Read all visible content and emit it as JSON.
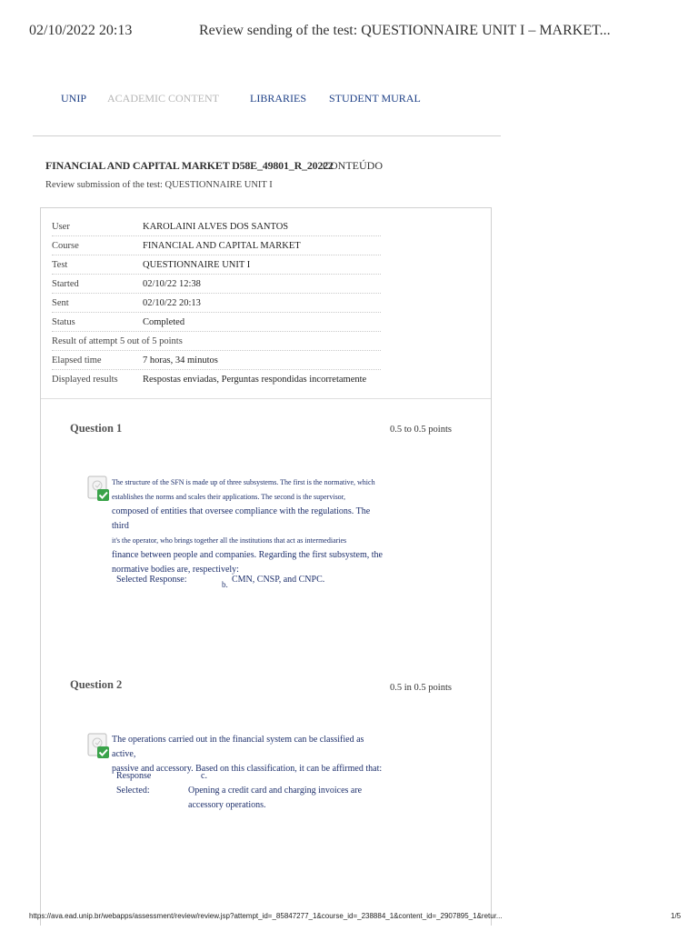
{
  "print": {
    "datetime": "02/10/2022 20:13",
    "title": "Review sending of the test: QUESTIONNAIRE UNIT I – MARKET...",
    "url": "https://ava.ead.unip.br/webapps/assessment/review/review.jsp?attempt_id=_85847277_1&course_id=_238884_1&content_id=_2907895_1&retur...",
    "page": "1/5"
  },
  "nav": {
    "unip": "UNIP",
    "academic": "ACADEMIC CONTENT",
    "libraries": "LIBRARIES",
    "mural": "STUDENT MURAL"
  },
  "course": {
    "title": "FINANCIAL AND CAPITAL MARKET D58E_49801_R_20222",
    "content_link": "CONTEÚDO",
    "review_subtitle": "Review submission of the test: QUESTIONNAIRE UNIT I"
  },
  "summary": {
    "user_label": "User",
    "user_value": "KAROLAINI ALVES DOS SANTOS",
    "course_label": "Course",
    "course_value": "FINANCIAL AND CAPITAL MARKET",
    "test_label": "Test",
    "test_value": "QUESTIONNAIRE UNIT I",
    "started_label": "Started",
    "started_value": "02/10/22 12:38",
    "sent_label": "Sent",
    "sent_value": "02/10/22 20:13",
    "status_label": "Status",
    "status_value": "Completed",
    "result_text": "Result of attempt 5 out of 5 points",
    "elapsed_label": "Elapsed time",
    "elapsed_value": "7 horas, 34 minutos",
    "displayed_label": "Displayed results",
    "displayed_value": "Respostas enviadas, Perguntas respondidas incorretamente"
  },
  "questions": [
    {
      "title": "Question 1",
      "points": "0.5 to 0.5 points",
      "line1": "The structure of the SFN is made up of three subsystems. The first is the normative, which",
      "line2": "establishes the norms and scales their applications. The second is the supervisor,",
      "line3": "composed of entities that oversee compliance with the regulations. The third",
      "line4": "it's the operator, who brings together all the institutions that act as intermediaries",
      "line5": "finance between people and companies. Regarding the first subsystem, the",
      "line6": "normative bodies are, respectively:",
      "response_label": "Selected Response:",
      "response_letter": "b.",
      "response_text": "CMN, CNSP, and CNPC."
    },
    {
      "title": "Question 2",
      "points": "0.5 in 0.5 points",
      "line1": "The operations carried out in the financial system can be classified as active,",
      "line2": "passive and accessory. Based on this classification, it can be affirmed that:",
      "response_label1": "Response",
      "response_label2": "Selected:",
      "response_letter": "c.",
      "response_text1": "Opening a credit card and charging invoices are",
      "response_text2": "accessory operations."
    }
  ],
  "colors": {
    "nav_link": "#1d3f86",
    "nav_muted": "#b5b5b5",
    "question_text": "#1d2f6b",
    "check_green": "#3aa34a"
  },
  "icons": {
    "correct": "correct-answer-check-icon"
  }
}
